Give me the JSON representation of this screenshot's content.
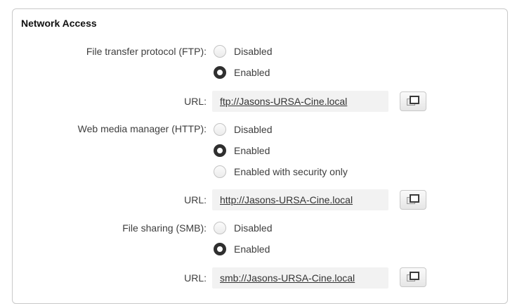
{
  "section": {
    "title": "Network Access"
  },
  "ftp": {
    "label": "File transfer protocol (FTP):",
    "options": [
      {
        "label": "Disabled",
        "selected": false
      },
      {
        "label": "Enabled",
        "selected": true
      }
    ],
    "url_label": "URL:",
    "url": "ftp://Jasons-URSA-Cine.local",
    "copy_icon": "copy-icon"
  },
  "http": {
    "label": "Web media manager (HTTP):",
    "options": [
      {
        "label": "Disabled",
        "selected": false
      },
      {
        "label": "Enabled",
        "selected": true
      },
      {
        "label": "Enabled with security only",
        "selected": false
      }
    ],
    "url_label": "URL:",
    "url": "http://Jasons-URSA-Cine.local",
    "copy_icon": "copy-icon"
  },
  "smb": {
    "label": "File sharing (SMB):",
    "options": [
      {
        "label": "Disabled",
        "selected": false
      },
      {
        "label": "Enabled",
        "selected": true
      }
    ],
    "url_label": "URL:",
    "url": "smb://Jasons-URSA-Cine.local",
    "copy_icon": "copy-icon"
  },
  "colors": {
    "selected_radio": "#2f2f2f",
    "url_field_bg": "#f2f2f2",
    "panel_border": "#c9c9c9"
  }
}
